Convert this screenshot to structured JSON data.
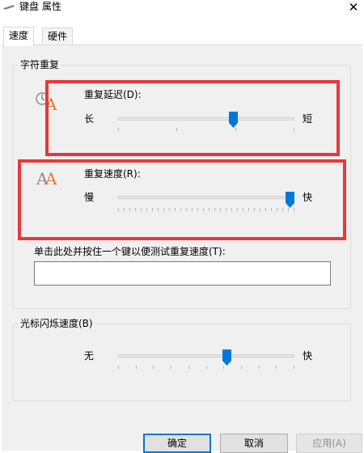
{
  "window": {
    "title": "键盘 属性",
    "close_symbol": "✕"
  },
  "tabs": [
    {
      "label": "速度",
      "active": true
    },
    {
      "label": "硬件",
      "active": false
    }
  ],
  "char_repeat": {
    "group_label": "字符重复",
    "delay": {
      "label": "重复延迟(D):",
      "min_label": "长",
      "max_label": "短",
      "value_fraction": 0.66
    },
    "rate": {
      "label": "重复速度(R):",
      "min_label": "慢",
      "max_label": "快",
      "value_fraction": 1.0
    },
    "test": {
      "label": "单击此处并按住一个键以便测试重复速度(T):",
      "value": ""
    }
  },
  "cursor_blink": {
    "group_label": "光标闪烁速度(B)",
    "min_label": "无",
    "max_label": "快",
    "value_fraction": 0.625
  },
  "buttons": {
    "ok": "确定",
    "cancel": "取消",
    "apply": "应用(A)"
  },
  "colors": {
    "highlight": "#e8383a",
    "accent": "#0078d7"
  },
  "icons": {
    "title": "keyboard-icon",
    "delay": "clock-letter-a-icon",
    "rate": "double-letter-a-icon"
  }
}
